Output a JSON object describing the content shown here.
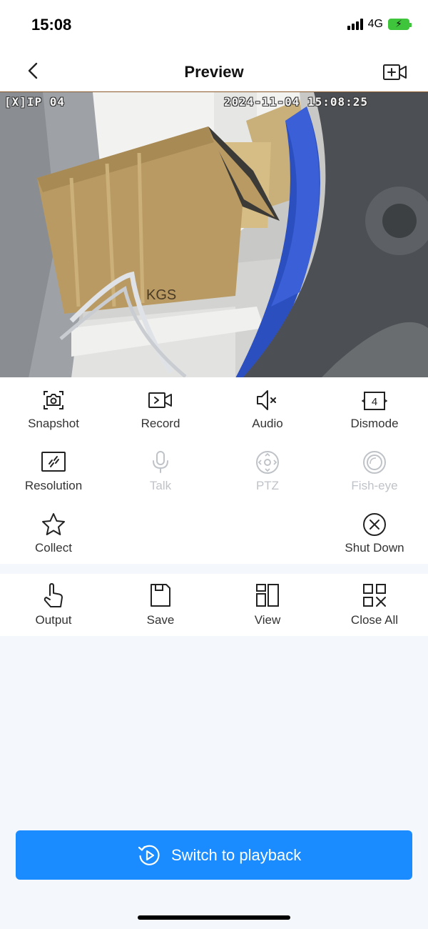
{
  "status_bar": {
    "time": "15:08",
    "network": "4G",
    "battery_color": "#3ec53b"
  },
  "nav": {
    "title": "Preview",
    "back_icon": "chevron-left-icon",
    "action_icon": "add-camera-icon"
  },
  "video": {
    "channel_label": "[X]IP 04",
    "timestamp": "2024-11-04  15:08:25"
  },
  "controls": [
    {
      "label": "Snapshot",
      "icon": "camera-icon",
      "enabled": true
    },
    {
      "label": "Record",
      "icon": "video-record-icon",
      "enabled": true
    },
    {
      "label": "Audio",
      "icon": "speaker-muted-icon",
      "enabled": true
    },
    {
      "label": "Dismode",
      "icon": "split-4-icon",
      "enabled": true
    },
    {
      "label": "Resolution",
      "icon": "resolution-icon",
      "enabled": true
    },
    {
      "label": "Talk",
      "icon": "microphone-icon",
      "enabled": false
    },
    {
      "label": "PTZ",
      "icon": "ptz-icon",
      "enabled": false
    },
    {
      "label": "Fish-eye",
      "icon": "fisheye-icon",
      "enabled": false
    },
    {
      "label": "Collect",
      "icon": "star-icon",
      "enabled": true
    },
    {
      "label": "Shut Down",
      "icon": "close-circle-icon",
      "enabled": true
    }
  ],
  "bottom_tools": [
    {
      "label": "Output",
      "icon": "hand-pointer-icon"
    },
    {
      "label": "Save",
      "icon": "save-icon"
    },
    {
      "label": "View",
      "icon": "view-layout-icon"
    },
    {
      "label": "Close All",
      "icon": "close-all-icon"
    }
  ],
  "playback_button": {
    "label": "Switch to playback",
    "icon": "replay-icon",
    "color": "#1a8cff"
  },
  "colors": {
    "accent": "#1a8cff",
    "disabled": "#bfc3c8",
    "background": "#f4f7fb"
  }
}
